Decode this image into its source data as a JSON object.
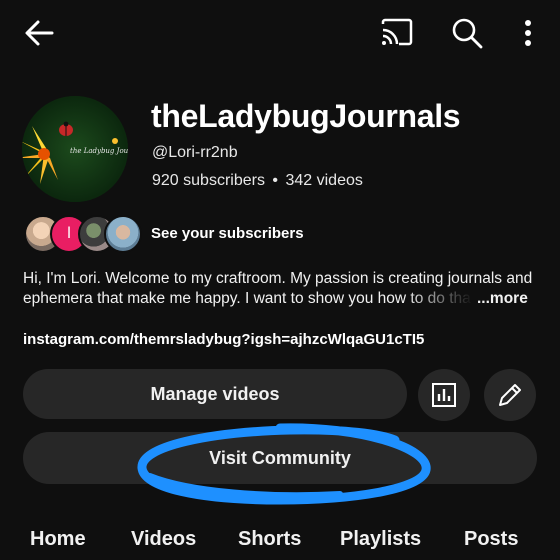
{
  "top_bar": {
    "icons": [
      "back-arrow-icon",
      "cast-icon",
      "search-icon",
      "more-vert-icon"
    ]
  },
  "channel": {
    "name": "theLadybugJournals",
    "handle": "@Lori-rr2nb",
    "subscribers": "920 subscribers",
    "separator": "•",
    "videos": "342 videos",
    "avatar_text": "the Ladybug Journals"
  },
  "subscribers_row": {
    "label": "See your subscribers",
    "initial": "l"
  },
  "description": {
    "line1": "Hi, I'm Lori. Welcome to my craftroom. My passion is creating journals and",
    "line2": "ephemera that make me happy. I want to show you how to do tha",
    "more": "...more"
  },
  "link": "instagram.com/themrsladybug?igsh=ajhzcWlqaGU1cTI5",
  "buttons": {
    "manage": "Manage videos",
    "community": "Visit Community",
    "analytics_icon": "analytics-icon",
    "edit_icon": "pencil-icon"
  },
  "tabs": [
    "Home",
    "Videos",
    "Shorts",
    "Playlists",
    "Posts"
  ],
  "colors": {
    "background": "#0f0f0f",
    "button": "#272727",
    "scribble": "#1e90ff",
    "initial_badge": "#e91e63"
  }
}
